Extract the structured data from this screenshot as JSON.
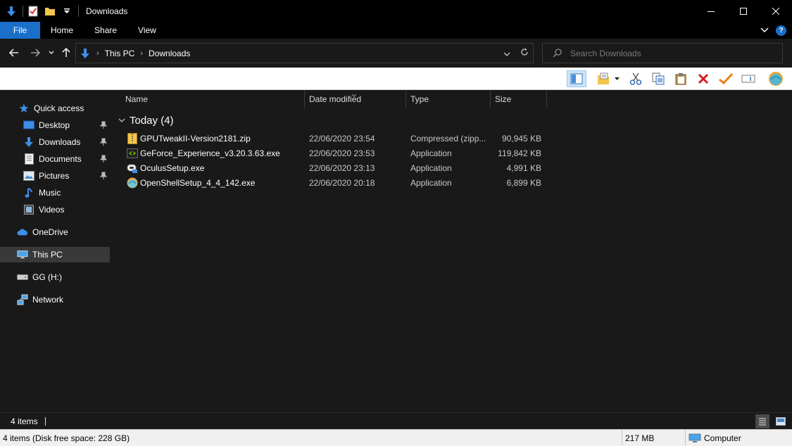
{
  "window": {
    "title": "Downloads",
    "controls": {
      "minimize": "—",
      "maximize": "☐",
      "close": "✕"
    }
  },
  "ribbon": {
    "tabs": [
      "File",
      "Home",
      "Share",
      "View"
    ]
  },
  "address": {
    "crumbs": [
      "This PC",
      "Downloads"
    ],
    "search_placeholder": "Search Downloads"
  },
  "sidebar": {
    "items": [
      {
        "label": "Quick access",
        "icon": "star-icon",
        "pinned": false
      },
      {
        "label": "Desktop",
        "icon": "desktop-icon",
        "pinned": true
      },
      {
        "label": "Downloads",
        "icon": "download-icon",
        "pinned": true
      },
      {
        "label": "Documents",
        "icon": "documents-icon",
        "pinned": true
      },
      {
        "label": "Pictures",
        "icon": "pictures-icon",
        "pinned": true
      },
      {
        "label": "Music",
        "icon": "music-icon",
        "pinned": false
      },
      {
        "label": "Videos",
        "icon": "videos-icon",
        "pinned": false
      },
      {
        "label": "OneDrive",
        "icon": "cloud-icon",
        "pinned": false
      },
      {
        "label": "This PC",
        "icon": "computer-icon",
        "pinned": false
      },
      {
        "label": "GG (H:)",
        "icon": "drive-icon",
        "pinned": false
      },
      {
        "label": "Network",
        "icon": "network-icon",
        "pinned": false
      }
    ]
  },
  "columns": {
    "name": "Name",
    "date": "Date modified",
    "type": "Type",
    "size": "Size"
  },
  "group": {
    "label": "Today (4)"
  },
  "files": [
    {
      "name": "GPUTweakII-Version2181.zip",
      "date": "22/06/2020 23:54",
      "type": "Compressed (zipp...",
      "size": "90,945 KB",
      "icon": "zip-icon"
    },
    {
      "name": "GeForce_Experience_v3.20.3.63.exe",
      "date": "22/06/2020 23:53",
      "type": "Application",
      "size": "119,842 KB",
      "icon": "nvidia-icon"
    },
    {
      "name": "OculusSetup.exe",
      "date": "22/06/2020 23:13",
      "type": "Application",
      "size": "4,991 KB",
      "icon": "oculus-icon"
    },
    {
      "name": "OpenShellSetup_4_4_142.exe",
      "date": "22/06/2020 20:18",
      "type": "Application",
      "size": "6,899 KB",
      "icon": "shell-icon"
    }
  ],
  "status": {
    "item_count": "4 items",
    "details": "4 items (Disk free space: 228 GB)",
    "size": "217 MB",
    "location": "Computer"
  },
  "colors": {
    "accent": "#1a6fc9",
    "background": "#191919",
    "titlebar": "#000000"
  }
}
